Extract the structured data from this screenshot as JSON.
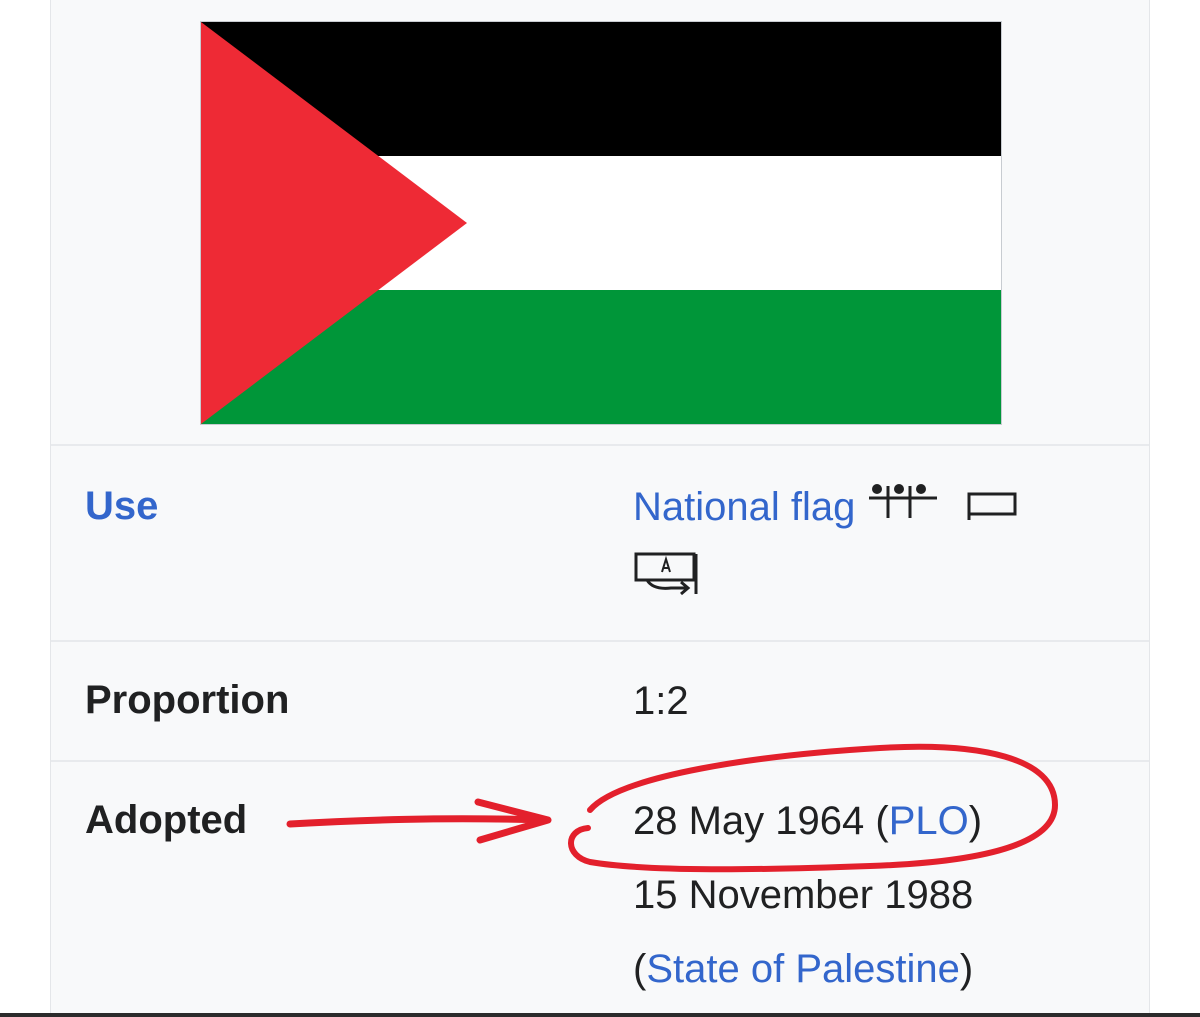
{
  "infobox": {
    "flag": {
      "icon": "palestinian-flag",
      "colors": {
        "black": "#000000",
        "white": "#ffffff",
        "green": "#009639",
        "red": "#ee2a35"
      }
    },
    "rows": {
      "use": {
        "label": "Use",
        "value": "National flag",
        "icons": [
          "flag-symbol-icon",
          "flag-rectangle-icon",
          "reverse-side-icon"
        ]
      },
      "proportion": {
        "label": "Proportion",
        "value": "1:2"
      },
      "adopted": {
        "label": "Adopted",
        "line1_date": "28 May 1964",
        "line1_link": "PLO",
        "line2_date": "15 November 1988",
        "line3_link": "State of Palestine"
      }
    }
  },
  "annotation": {
    "color": "#e3202c",
    "shapes": [
      "arrow",
      "circle"
    ]
  }
}
